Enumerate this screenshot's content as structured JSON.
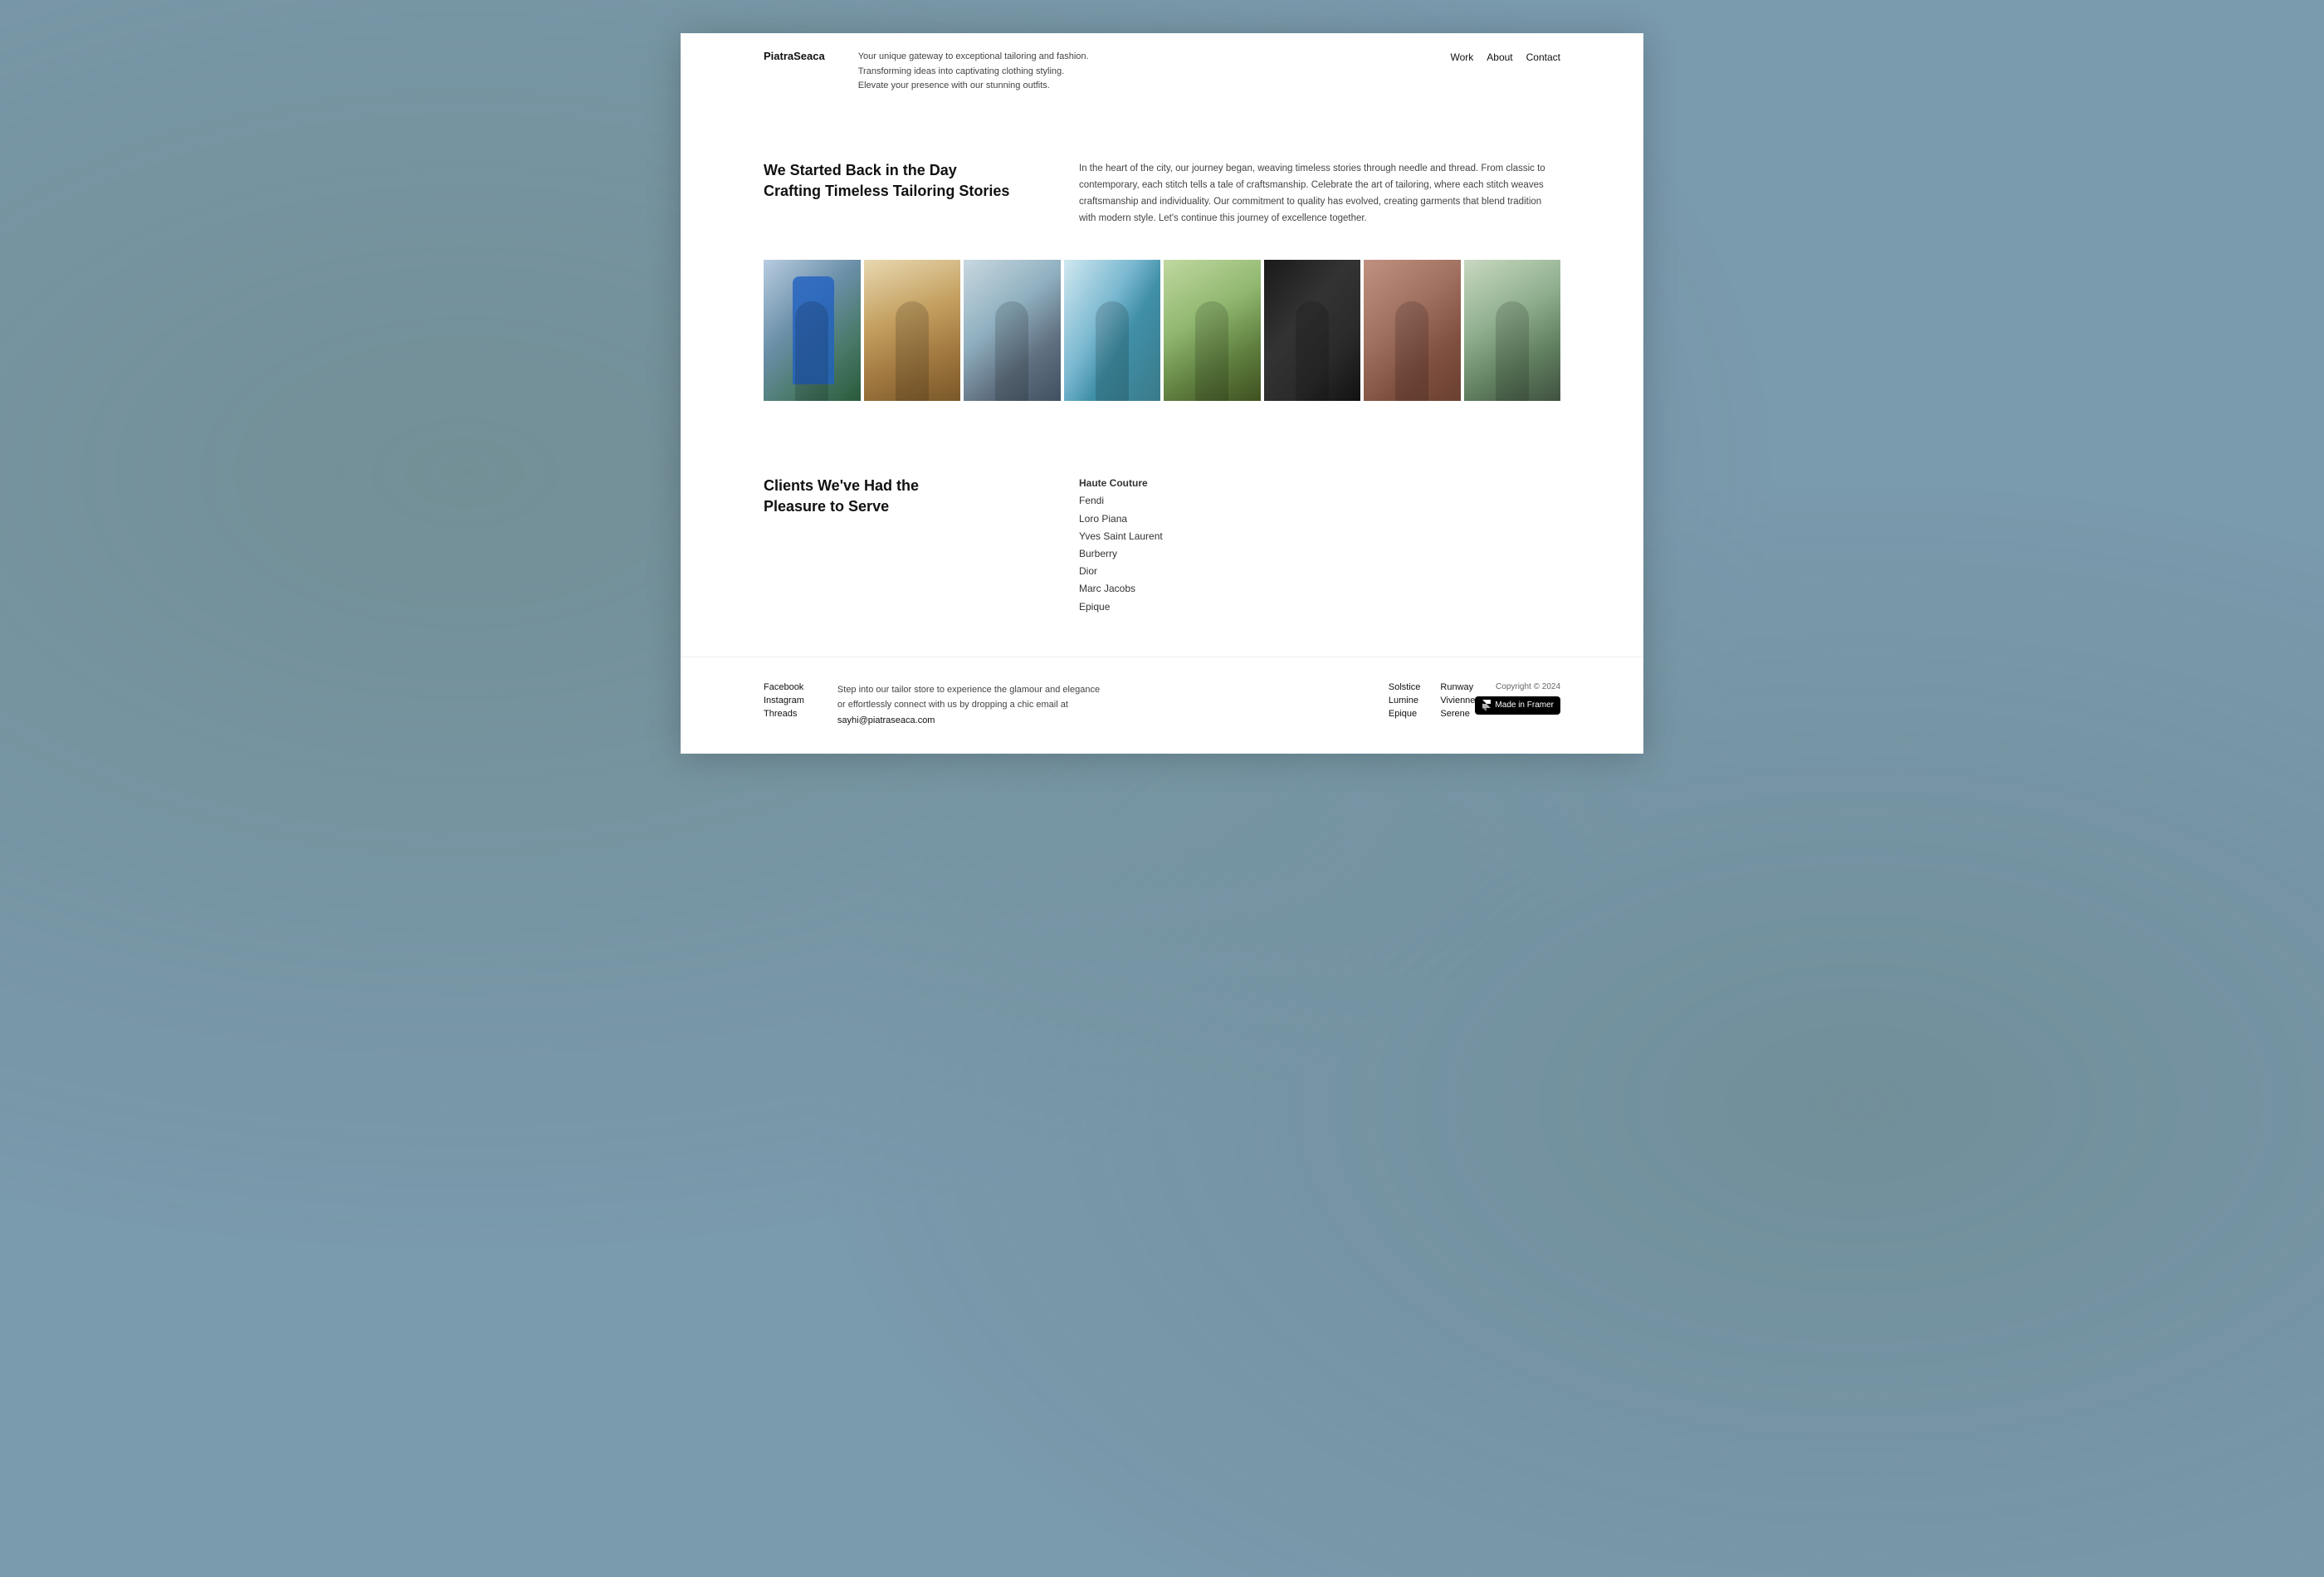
{
  "header": {
    "logo": "PiatraSeaca",
    "tagline_line1": "Your unique gateway to exceptional tailoring and fashion.",
    "tagline_line2": "Transforming ideas into captivating clothing styling.",
    "tagline_line3": "Elevate your presence with our stunning outfits.",
    "nav": {
      "work": "Work",
      "about": "About",
      "contact": "Contact"
    }
  },
  "hero": {
    "title_line1": "We Started Back in the Day",
    "title_line2": "Crafting Timeless Tailoring Stories",
    "description": "In the heart of the city, our journey began, weaving timeless stories through needle and thread. From classic to contemporary, each stitch tells a tale of craftsmanship. Celebrate the art of tailoring, where each stitch weaves craftsmanship and individuality. Our commitment to quality has evolved, creating garments that blend tradition with modern style. Let's continue this journey of excellence together."
  },
  "gallery": {
    "images": [
      {
        "alt": "Blue suit fashion photo"
      },
      {
        "alt": "Golden field fashion photo"
      },
      {
        "alt": "Water fashion photo"
      },
      {
        "alt": "Rocky terrain fashion photo"
      },
      {
        "alt": "Field with sheep fashion photo"
      },
      {
        "alt": "Black dress fashion photo"
      },
      {
        "alt": "Warm toned fashion photo"
      },
      {
        "alt": "Riverside fashion photo"
      }
    ]
  },
  "clients": {
    "title_line1": "Clients We've Had the",
    "title_line2": "Pleasure to Serve",
    "list": [
      {
        "name": "Haute Couture",
        "highlight": true
      },
      {
        "name": "Fendi",
        "highlight": false
      },
      {
        "name": "Loro Piana",
        "highlight": false
      },
      {
        "name": "Yves Saint Laurent",
        "highlight": false
      },
      {
        "name": "Burberry",
        "highlight": false
      },
      {
        "name": "Dior",
        "highlight": false
      },
      {
        "name": "Marc Jacobs",
        "highlight": false
      },
      {
        "name": "Epique",
        "highlight": false
      }
    ]
  },
  "footer": {
    "social": {
      "facebook": "Facebook",
      "instagram": "Instagram",
      "threads": "Threads"
    },
    "tagline_line1": "Step into our tailor store to experience the glamour and elegance",
    "tagline_line2": "or effortlessly connect with us by dropping a chic email at",
    "email": "sayhi@piatraseaca.com",
    "links_col1": [
      "Solstice",
      "Lumine",
      "Epique"
    ],
    "links_col2": [
      "Runway",
      "Vivienne",
      "Serene"
    ],
    "copyright": "Copyright © 2024",
    "made_in_framer": "Made in Framer"
  }
}
